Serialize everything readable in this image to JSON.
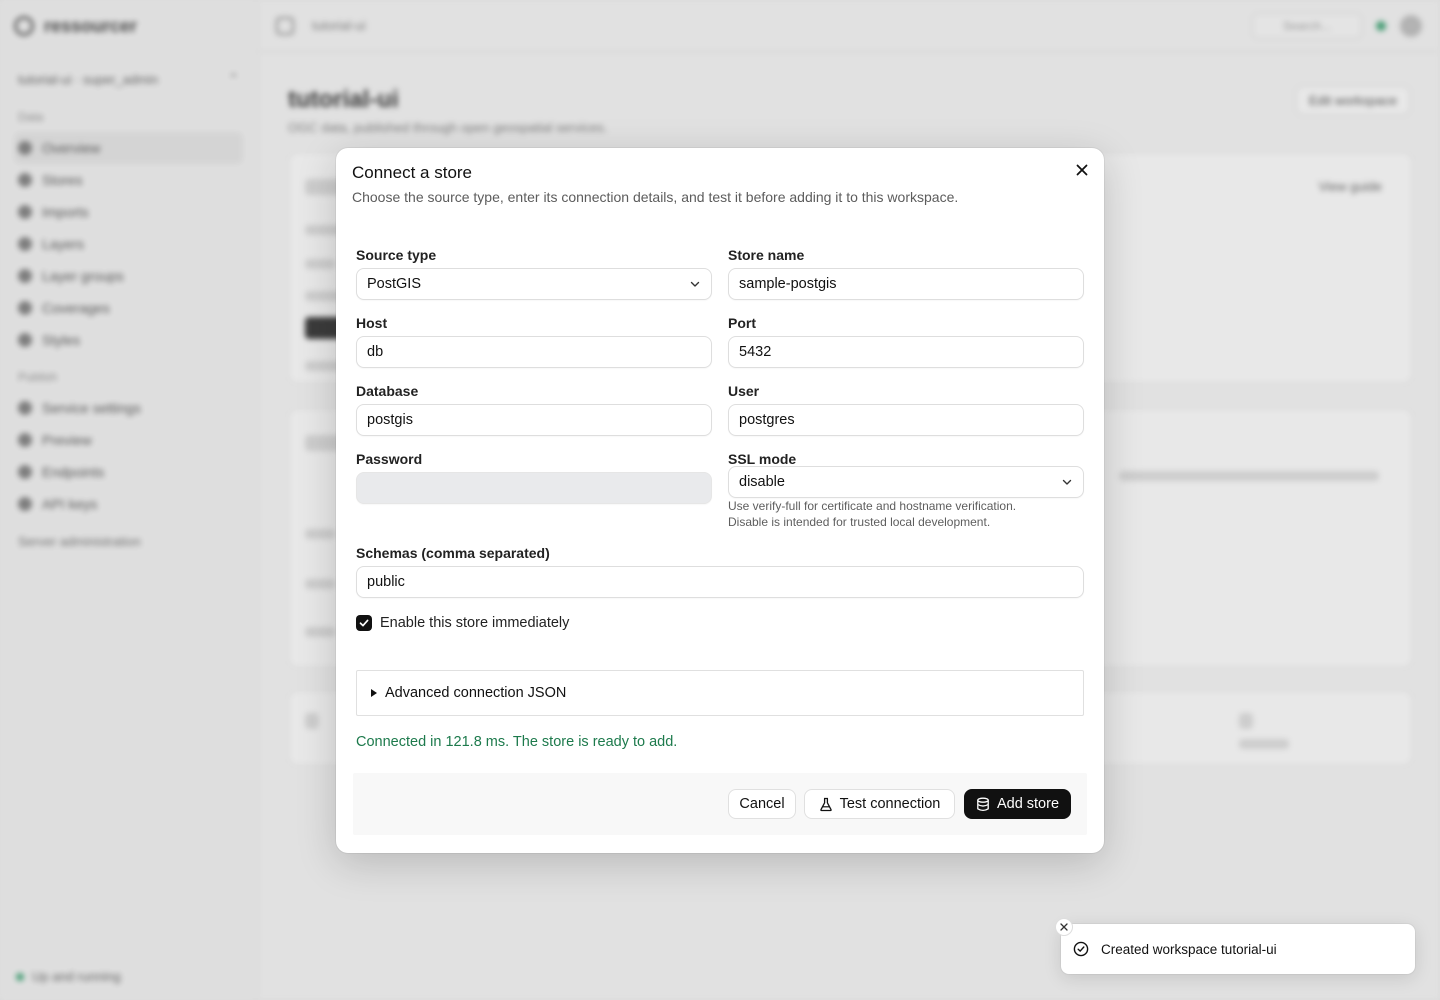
{
  "background": {
    "brand": "ressourcer",
    "workspace_switch": "tutorial-ui · super_admin",
    "nav_section_main": "Data",
    "nav_main": [
      "Overview",
      "Stores",
      "Imports",
      "Layers",
      "Layer groups",
      "Coverages",
      "Styles"
    ],
    "nav_section_publish": "Publish",
    "nav_publish": [
      "Service settings",
      "Preview",
      "Endpoints",
      "API keys"
    ],
    "misc": [
      "Server administration"
    ],
    "status": "Up and running",
    "breadcrumb": "tutorial-ui",
    "search_placeholder": "Search...",
    "page_title": "tutorial-ui",
    "page_subtitle": "OGC data, published through open geospatial services.",
    "edit_button": "Edit workspace",
    "card_link": "View guide"
  },
  "modal": {
    "title": "Connect a store",
    "description": "Choose the source type, enter its connection details, and test it before adding it to this workspace.",
    "fields": {
      "source_type": {
        "label": "Source type",
        "value": "PostGIS"
      },
      "store_name": {
        "label": "Store name",
        "value": "sample-postgis"
      },
      "host": {
        "label": "Host",
        "value": "db"
      },
      "port": {
        "label": "Port",
        "value": "5432"
      },
      "database": {
        "label": "Database",
        "value": "postgis"
      },
      "user": {
        "label": "User",
        "value": "postgres"
      },
      "password": {
        "label": "Password",
        "value": ""
      },
      "ssl_mode": {
        "label": "SSL mode",
        "value": "disable",
        "hint_line1": "Use verify-full for certificate and hostname verification.",
        "hint_line2": "Disable is intended for trusted local development."
      },
      "schemas": {
        "label": "Schemas (comma separated)",
        "value": "public"
      }
    },
    "enable_checkbox": {
      "label": "Enable this store immediately",
      "checked": true
    },
    "advanced_label": "Advanced connection JSON",
    "status_message": "Connected in 121.8 ms. The store is ready to add.",
    "buttons": {
      "cancel": "Cancel",
      "test": "Test connection",
      "add": "Add store"
    }
  },
  "toast": {
    "message": "Created workspace tutorial-ui"
  },
  "colors": {
    "success": "#1d7a4c",
    "primary": "#111111",
    "status_dot": "#2f9e6a"
  }
}
